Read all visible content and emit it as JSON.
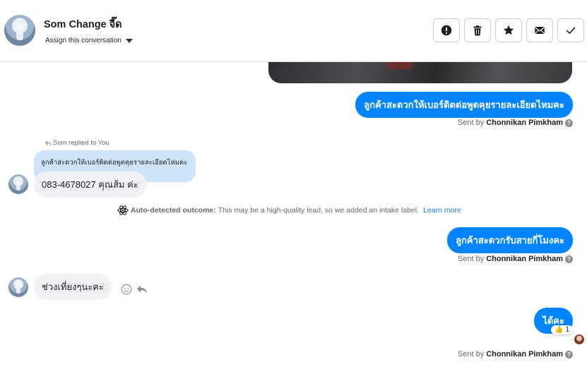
{
  "header": {
    "contact_name": "Som Change จี๊ด",
    "assign_label": "Assign this conversation"
  },
  "toolbar": {
    "buttons": [
      {
        "name": "report-spam-button",
        "icon": "exclamation-circle-icon"
      },
      {
        "name": "delete-button",
        "icon": "trash-icon"
      },
      {
        "name": "star-button",
        "icon": "star-icon"
      },
      {
        "name": "mark-unread-button",
        "icon": "envelope-icon"
      },
      {
        "name": "mark-done-button",
        "icon": "checkmark-icon"
      }
    ]
  },
  "conversation": {
    "messages": [
      {
        "direction": "outgoing",
        "text": "ลูกค้าสะดวกให้เบอร์ติดต่อพูดคุยรายละเอียดไหมคะ",
        "sent_by_prefix": "Sent by",
        "sent_by": "Chonnikan Pimkham"
      },
      {
        "direction": "incoming",
        "replied_to": "Som replied to You",
        "quoted_text": "ลูกค้าสะดวกให้เบอร์ติดต่อพูดคุยรายละเอียดไหมคะ",
        "text": "083-4678027 คุณส้ม ค่ะ"
      },
      {
        "direction": "outgoing",
        "text": "ลูกค้าสะดวกรับสายกี่โมงคะ",
        "sent_by_prefix": "Sent by",
        "sent_by": "Chonnikan Pimkham"
      },
      {
        "direction": "incoming",
        "text": "ช่วงเที่ยงๆนะคะ"
      },
      {
        "direction": "outgoing",
        "text": "ได้คะ",
        "reaction_emoji": "👍",
        "reaction_count": "1",
        "sent_by_prefix": "Sent by",
        "sent_by": "Chonnikan Pimkham"
      }
    ],
    "outcome": {
      "label": "Auto-detected outcome:",
      "text": "This may be a high-quality lead, so we added an intake label.",
      "link": "Learn more"
    },
    "help_glyph": "?"
  },
  "colors": {
    "outgoing_bubble": "#0084ff",
    "incoming_bubble": "#f0f2f5",
    "quoted_bubble": "#cfe3fb",
    "link": "#1877f2"
  }
}
